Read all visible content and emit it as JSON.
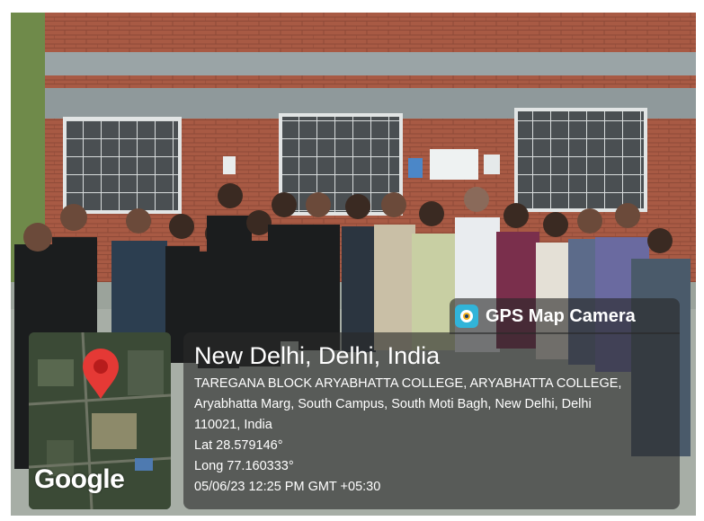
{
  "overlay": {
    "app_name": "GPS Map Camera",
    "app_icon": "camera-icon",
    "map_brand": "Google",
    "place_title": "New Delhi, Delhi, India",
    "address_line_1": "TAREGANA BLOCK ARYABHATTA COLLEGE, ARYABHATTA COLLEGE,",
    "address_line_2": "Aryabhatta Marg, South Campus, South Moti Bagh, New Delhi, Delhi",
    "address_line_3": "110021, India",
    "lat": "Lat 28.579146°",
    "long": "Long 77.160333°",
    "timestamp": "05/06/23 12:25 PM GMT +05:30",
    "pin_color": "#e53935"
  }
}
